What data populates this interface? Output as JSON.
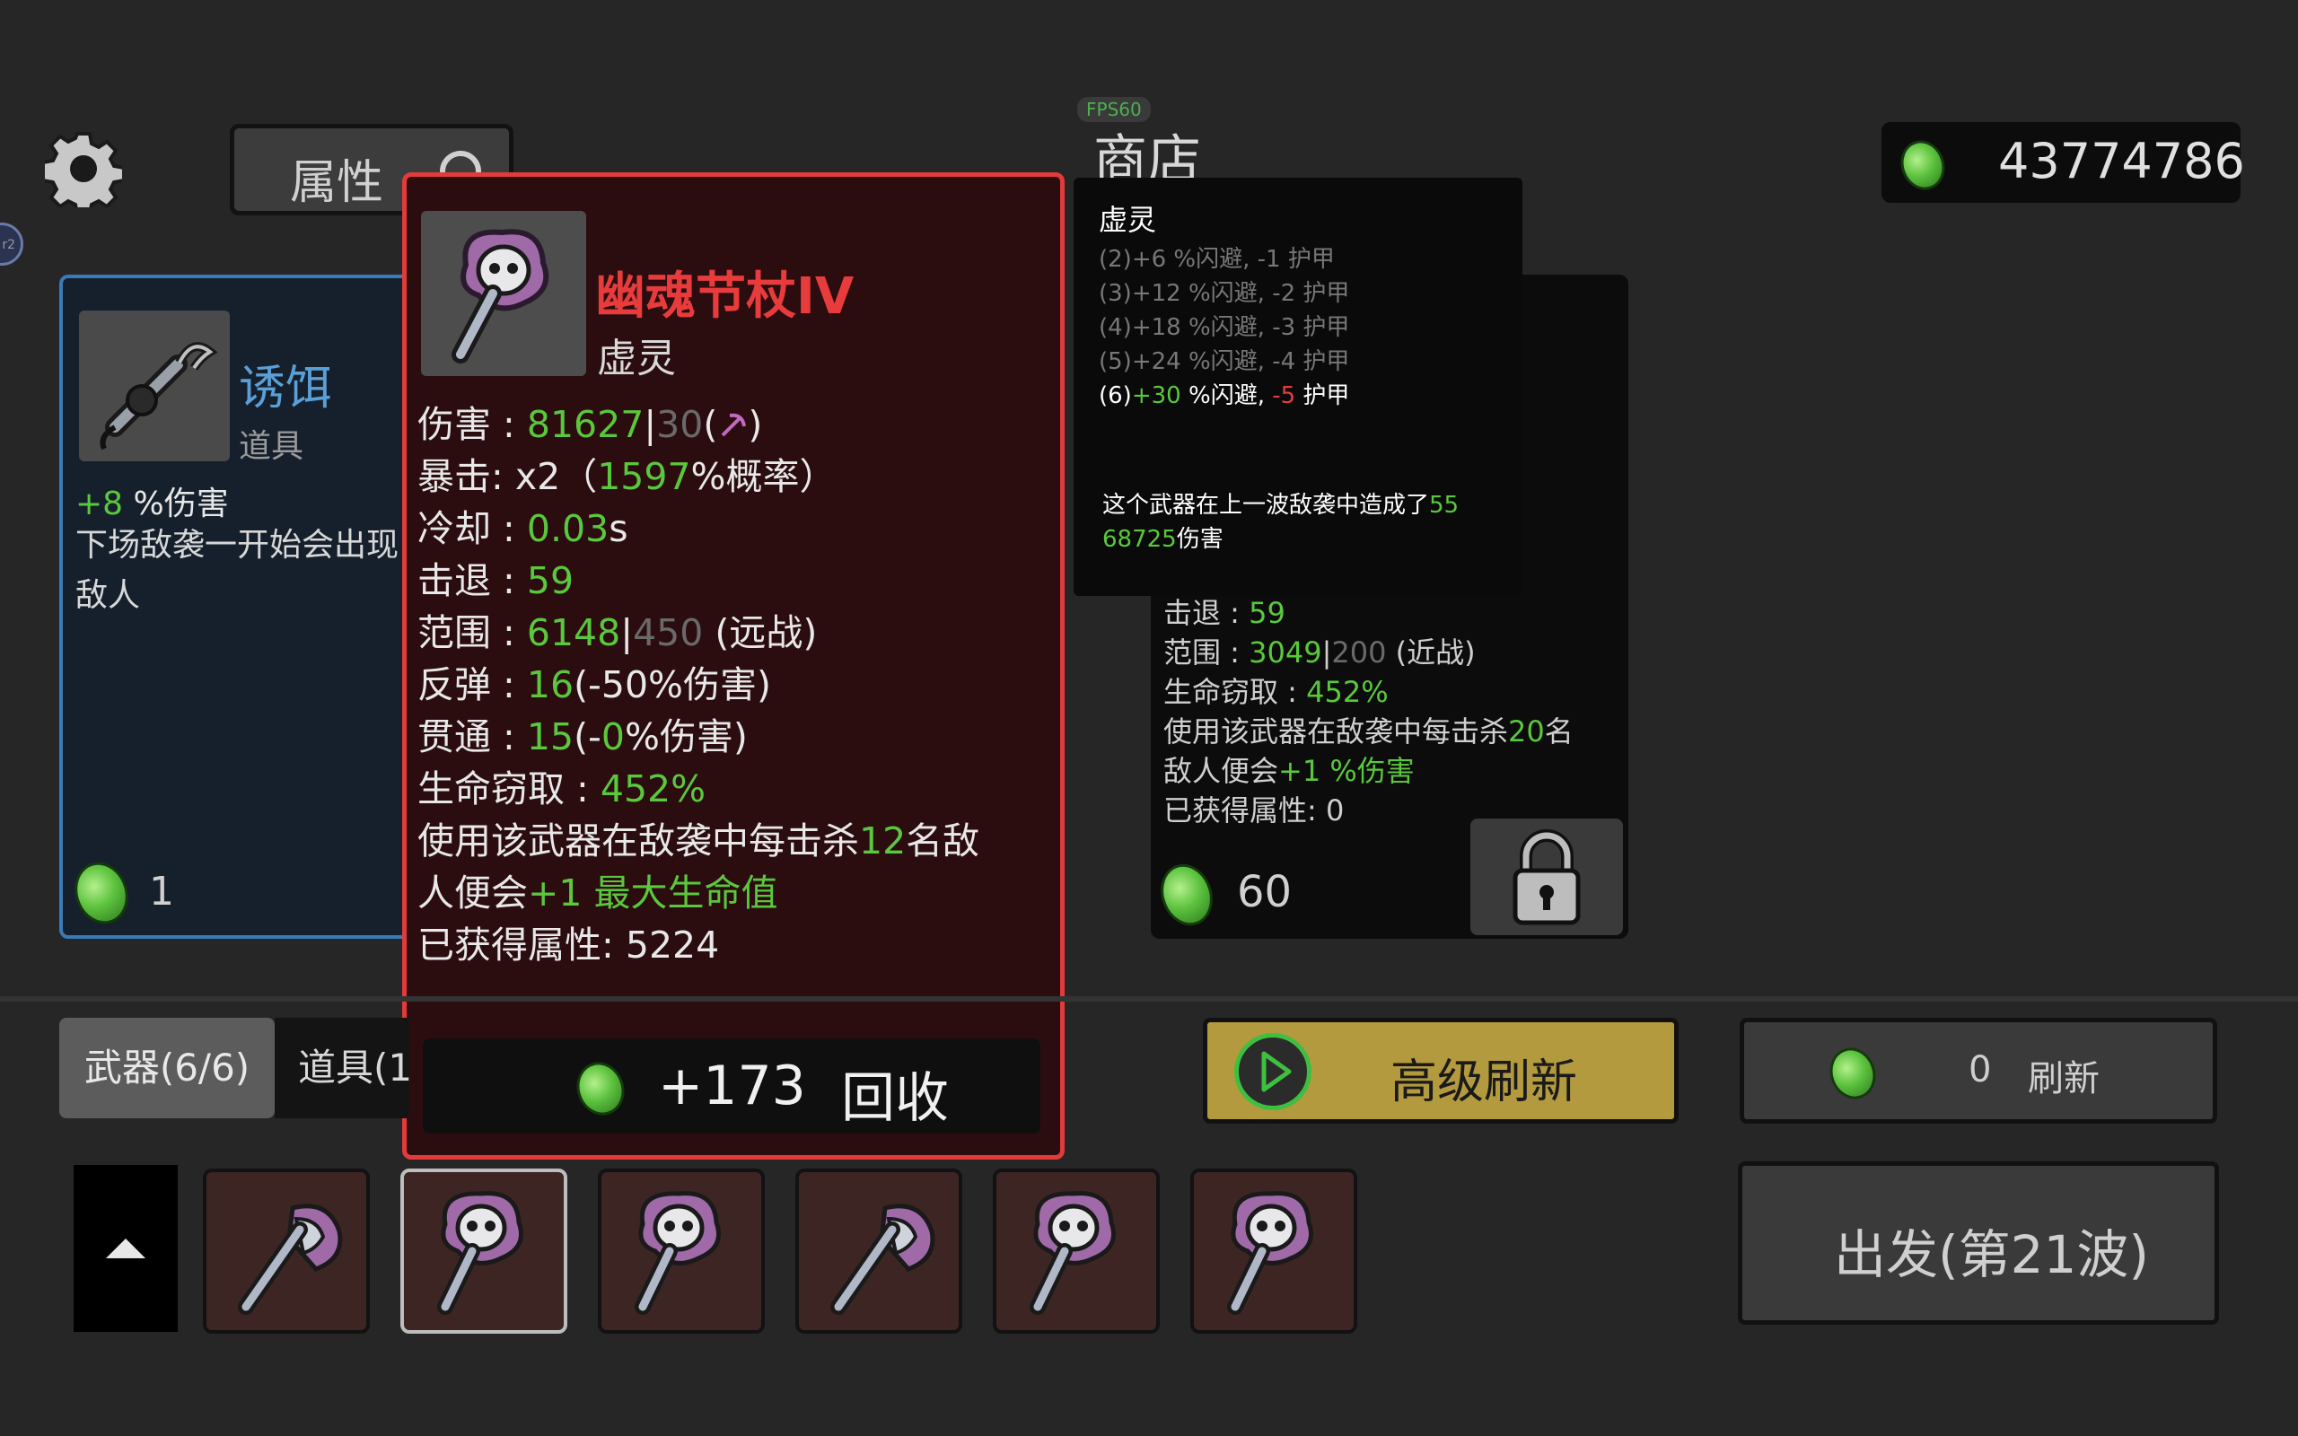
{
  "header": {
    "fps": "FPS60",
    "title": "商店",
    "attr_button": "属性",
    "money": "43774786"
  },
  "bait_card": {
    "name": "诱饵",
    "type": "道具",
    "effect_value": "+8",
    "effect_text": " %伤害",
    "desc_line1": "下场敌袭一开始会出现",
    "desc_line2": "敌人",
    "price": "1"
  },
  "tooltip": {
    "name": "幽魂节杖IV",
    "class": "虚灵",
    "damage_label": "伤害 : ",
    "damage_value": "81627",
    "damage_base": "30",
    "crit_label": "暴击:  x2（",
    "crit_value": "1597",
    "crit_suffix": "%概率）",
    "cooldown_label": "冷却 : ",
    "cooldown_value": "0.03",
    "cooldown_unit": "s",
    "knockback_label": "击退 : ",
    "knockback_value": "59",
    "range_label": "范围 : ",
    "range_value": "6148",
    "range_base": "450",
    "range_type": " (远战)",
    "bounce_label": "反弹 : ",
    "bounce_value": "16",
    "bounce_suffix": "(-50%伤害)",
    "pierce_label": "贯通 : ",
    "pierce_value": "15",
    "pierce_pre": "(-",
    "pierce_num": "0",
    "pierce_suffix": "%伤害)",
    "lifesteal_label": "生命窃取 : ",
    "lifesteal_value": "452%",
    "kill_text1": "使用该武器在敌袭中每击杀",
    "kill_num": "12",
    "kill_text2": "名敌",
    "kill_text3": "人便会",
    "kill_bonus": "+1 最大生命值",
    "gained_label": "已获得属性:  ",
    "gained_value": "5224",
    "recycle_amount": "+173",
    "recycle_label": "回收"
  },
  "set_tooltip": {
    "title": "虚灵",
    "line2": "(2)+6 %闪避, -1 护甲",
    "line3": "(3)+12 %闪避, -2 护甲",
    "line4": "(4)+18 %闪避, -3 护甲",
    "line5": "(5)+24 %闪避, -4 护甲",
    "line6_pre": "(6)",
    "line6_dodge": "+30",
    "line6_mid": " %闪避, ",
    "line6_armor": "-5",
    "line6_end": " 护甲",
    "dmg_text": "这个武器在上一波敌袭中造成了",
    "dmg_value1": "55",
    "dmg_value2": "68725",
    "dmg_suffix": "伤害"
  },
  "axe_card": {
    "knockback_label": "击退 : ",
    "knockback_value": "59",
    "range_label": "范围 : ",
    "range_value": "3049",
    "range_base": "200",
    "range_type": " (近战)",
    "lifesteal_label": "生命窃取 : ",
    "lifesteal_value": "452%",
    "kill_text1": "使用该武器在敌袭中每击杀",
    "kill_num": "20",
    "kill_text2": "名",
    "kill_text3": "敌人便会",
    "kill_bonus": "+1 %伤害",
    "gained": "已获得属性:  0",
    "price": "60"
  },
  "bottom": {
    "tab_weapons": "武器(6/6)",
    "tab_items": "道具(1",
    "adv_refresh": "高级刷新",
    "refresh_cost": "0",
    "refresh_label": "刷新",
    "depart": "出发(第21波)"
  },
  "inventory": [
    "axe",
    "scepter",
    "scepter",
    "axe",
    "scepter",
    "scepter"
  ],
  "colors": {
    "accent_red": "#e33a3a",
    "stat_green": "#5ac83c",
    "refresh_gold": "#b39a3e",
    "bait_blue": "#5aa0d8"
  }
}
